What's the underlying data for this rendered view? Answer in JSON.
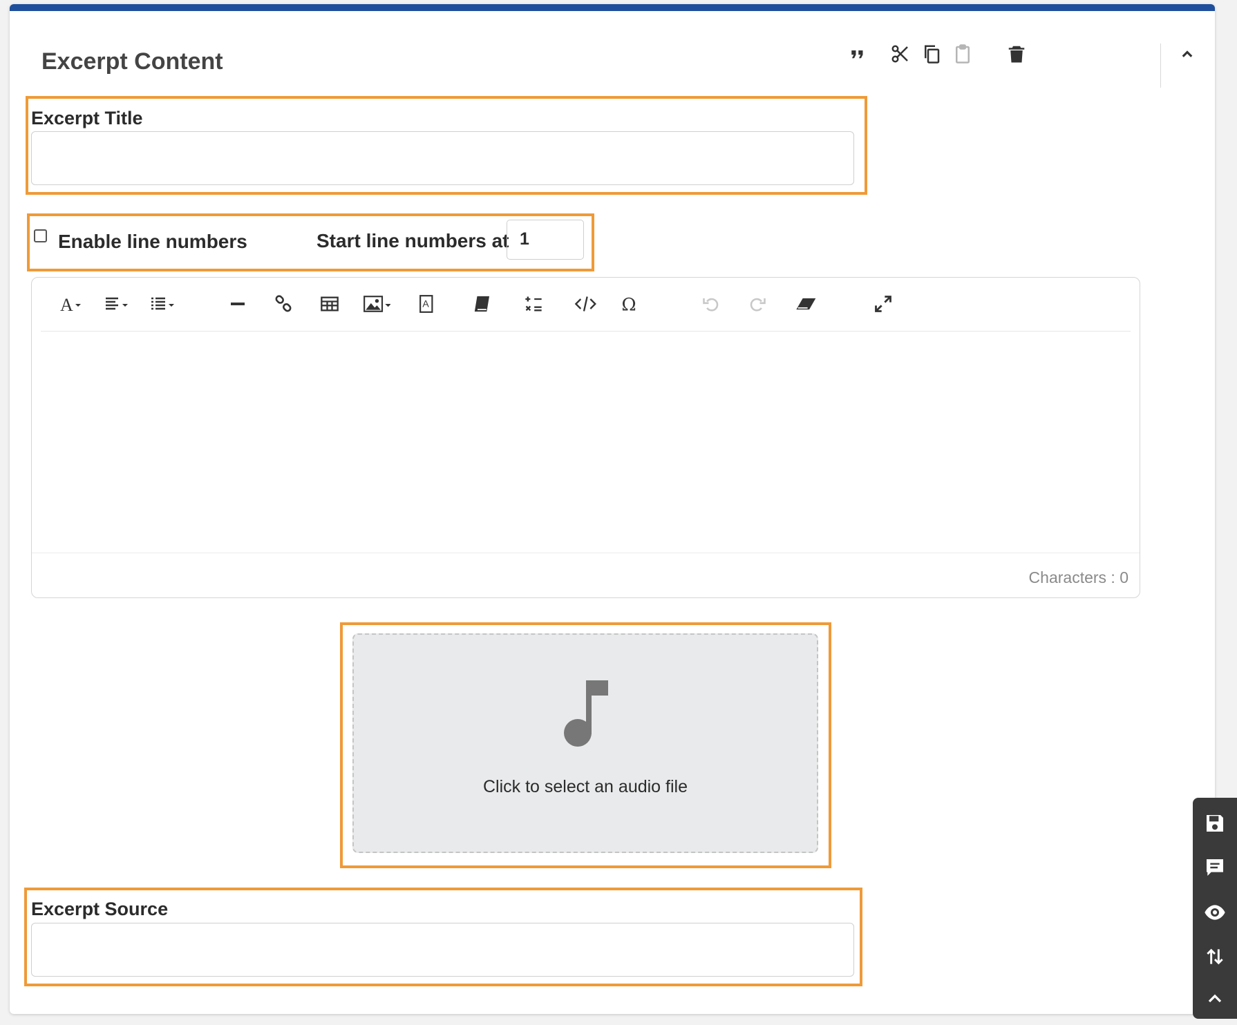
{
  "panel": {
    "title": "Excerpt Content",
    "accent_color": "#1f4f9c",
    "header_icons": [
      "quote-icon",
      "cut-icon",
      "copy-icon",
      "paste-icon",
      "trash-icon",
      "chevron-up-icon"
    ]
  },
  "excerpt_title": {
    "label": "Excerpt Title",
    "value": "",
    "placeholder": ""
  },
  "line_numbers": {
    "enable_label": "Enable line numbers",
    "enabled": false,
    "start_label": "Start line numbers at",
    "start_value": "1"
  },
  "editor": {
    "toolbar_icons": [
      "font-icon",
      "align-icon",
      "list-icon",
      "horizontal-line-icon",
      "link-icon",
      "table-icon",
      "image-icon",
      "text-box-icon",
      "book-icon",
      "math-icon",
      "code-icon",
      "omega-icon",
      "undo-icon",
      "redo-icon",
      "eraser-icon",
      "fullscreen-icon"
    ],
    "content": "",
    "char_count": "Characters : 0"
  },
  "audio": {
    "prompt": "Click to select an audio file",
    "icon": "music-note-icon"
  },
  "excerpt_source": {
    "label": "Excerpt Source",
    "value": "",
    "placeholder": ""
  },
  "side_toolbar": {
    "icons": [
      "save-icon",
      "comment-icon",
      "eye-icon",
      "reorder-icon",
      "chevron-up-icon"
    ]
  },
  "colors": {
    "highlight": "#ef9a38",
    "dropzone_bg": "#e9eaeb",
    "sidebar_bg": "#3a3a3a"
  }
}
